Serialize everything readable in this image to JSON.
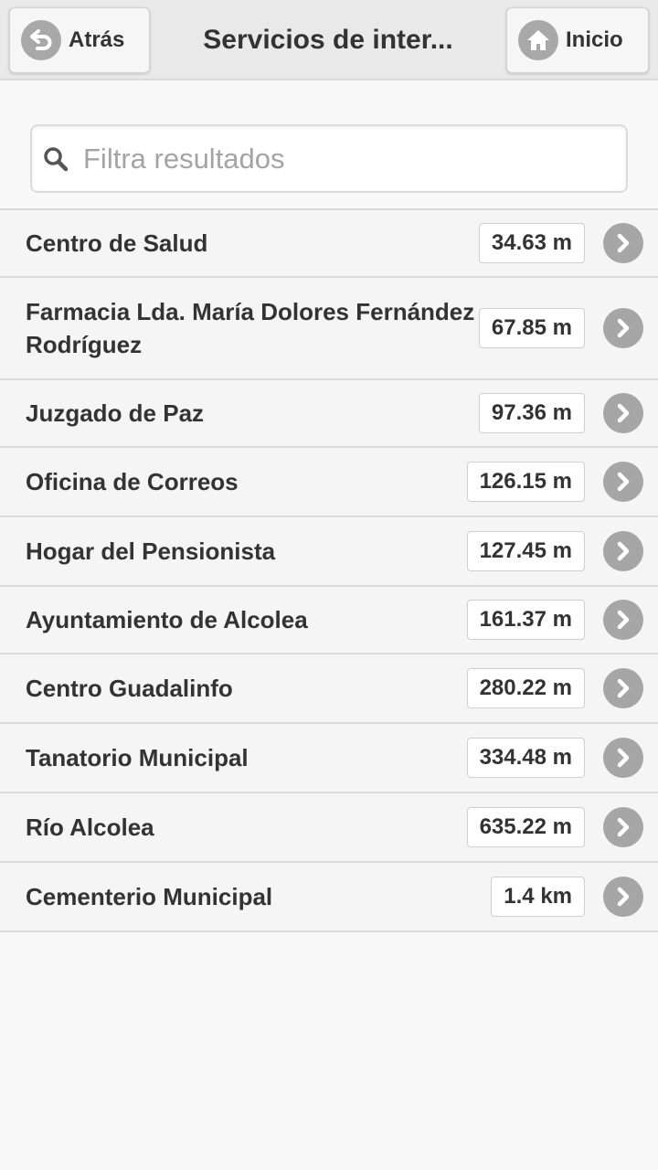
{
  "header": {
    "back_label": "Atrás",
    "title": "Servicios de inter...",
    "home_label": "Inicio"
  },
  "search": {
    "placeholder": "Filtra resultados",
    "value": ""
  },
  "items": [
    {
      "name": "Centro de Salud",
      "distance": "34.63 m"
    },
    {
      "name": "Farmacia Lda. María Dolores Fernández Rodríguez",
      "distance": "67.85 m"
    },
    {
      "name": "Juzgado de Paz",
      "distance": "97.36 m"
    },
    {
      "name": "Oficina de Correos",
      "distance": "126.15 m"
    },
    {
      "name": "Hogar del Pensionista",
      "distance": "127.45 m"
    },
    {
      "name": "Ayuntamiento de Alcolea",
      "distance": "161.37 m"
    },
    {
      "name": "Centro Guadalinfo",
      "distance": "280.22 m"
    },
    {
      "name": "Tanatorio Municipal",
      "distance": "334.48 m"
    },
    {
      "name": "Río Alcolea",
      "distance": "635.22 m"
    },
    {
      "name": "Cementerio Municipal",
      "distance": "1.4 km"
    }
  ],
  "icons": {
    "back": "back-arrow-icon",
    "home": "home-icon",
    "search": "search-icon",
    "row": "chevron-right-icon"
  }
}
